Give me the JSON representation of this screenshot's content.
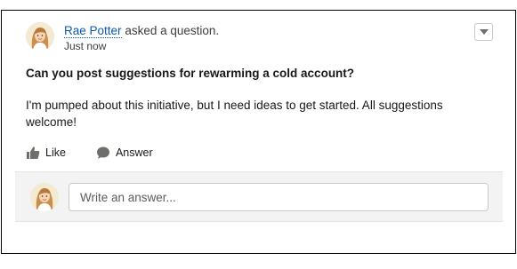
{
  "post": {
    "author_name": "Rae Potter",
    "author_action": "asked a question.",
    "timestamp": "Just now",
    "question_title": "Can you post suggestions for rewarming a cold account?",
    "question_body": "I'm pumped about this initiative, but I need ideas to get started. All suggestions welcome!",
    "menu_icon": "chevron-down-icon"
  },
  "actions": {
    "like_label": "Like",
    "like_icon": "thumbs-up-icon",
    "answer_label": "Answer",
    "answer_icon": "speech-bubble-icon"
  },
  "reply": {
    "placeholder": "Write an answer..."
  },
  "colors": {
    "link": "#0b5cab",
    "icon": "#706e6b",
    "reply_background": "#f3f3f3"
  }
}
